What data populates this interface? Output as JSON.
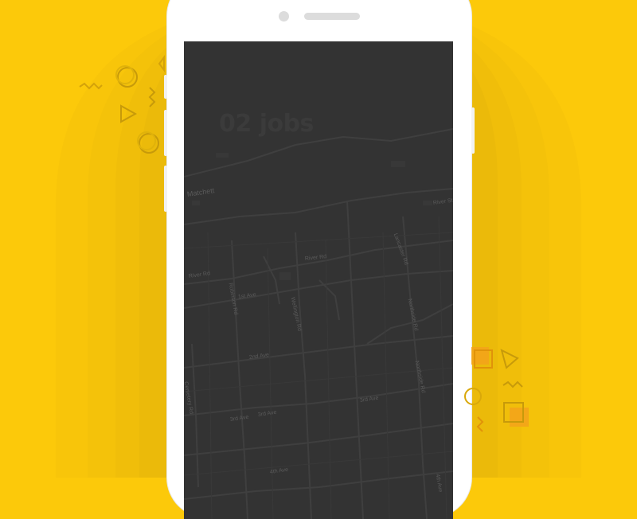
{
  "screen": {
    "title": "02 jobs"
  },
  "map": {
    "streets": [
      "Matchett",
      "River Rd",
      "River Rd",
      "Robinson Rd",
      "Lancaster Rd",
      "1st Ave",
      "Wellington Rd",
      "Northside Rd",
      "2nd Ave",
      "Northside Rd",
      "Cemetery Rd",
      "3rd Ave",
      "3rd Ave",
      "3rd Ave",
      "River St",
      "4th Ave",
      "4th Ave"
    ]
  },
  "colors": {
    "background": "#fcc90a",
    "band": "#f0c00a",
    "phone_body": "#ffffff",
    "screen": "#333333",
    "map_road": "#3d3d3d",
    "label": "#5a5a5a"
  }
}
